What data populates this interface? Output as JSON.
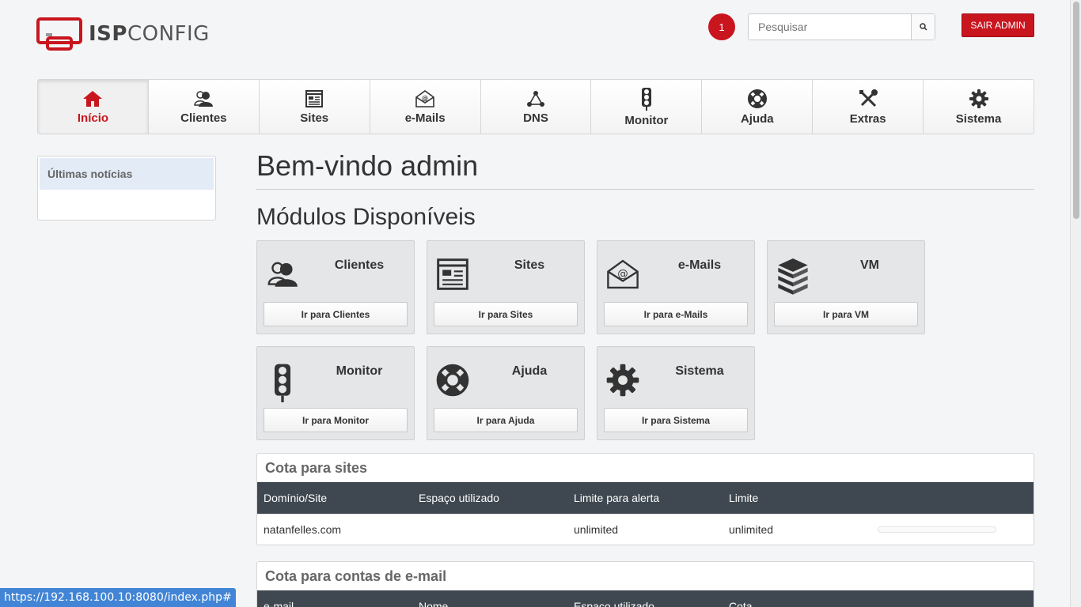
{
  "logo": {
    "text_bold": "ISP",
    "text_regular": "CONFIG"
  },
  "header": {
    "notification_count": "1",
    "search_placeholder": "Pesquisar",
    "logout_label": "SAIR ADMIN"
  },
  "nav": {
    "items": [
      {
        "label": "Início",
        "icon": "home-icon",
        "active": true
      },
      {
        "label": "Clientes",
        "icon": "users-icon"
      },
      {
        "label": "Sites",
        "icon": "web-page-icon"
      },
      {
        "label": "e-Mails",
        "icon": "mail-icon"
      },
      {
        "label": "DNS",
        "icon": "dns-icon"
      },
      {
        "label": "Monitor",
        "icon": "traffic-light-icon"
      },
      {
        "label": "Ajuda",
        "icon": "lifebuoy-icon"
      },
      {
        "label": "Extras",
        "icon": "tools-icon"
      },
      {
        "label": "Sistema",
        "icon": "gear-icon"
      }
    ]
  },
  "sidebar": {
    "items": [
      {
        "label": "Últimas notícias"
      }
    ]
  },
  "content": {
    "welcome_title": "Bem-vindo admin",
    "modules_title": "Módulos Disponíveis",
    "modules": [
      {
        "title": "Clientes",
        "button": "Ir para Clientes",
        "icon": "users-icon"
      },
      {
        "title": "Sites",
        "button": "Ir para Sites",
        "icon": "web-page-icon"
      },
      {
        "title": "e-Mails",
        "button": "Ir para e-Mails",
        "icon": "mail-icon"
      },
      {
        "title": "VM",
        "button": "Ir para VM",
        "icon": "server-stack-icon"
      },
      {
        "title": "Monitor",
        "button": "Ir para Monitor",
        "icon": "traffic-light-icon"
      },
      {
        "title": "Ajuda",
        "button": "Ir para Ajuda",
        "icon": "lifebuoy-icon"
      },
      {
        "title": "Sistema",
        "button": "Ir para Sistema",
        "icon": "gear-icon"
      }
    ]
  },
  "site_quota": {
    "title": "Cota para sites",
    "headers": [
      "Domínio/Site",
      "Espaço utilizado",
      "Limite para alerta",
      "Limite"
    ],
    "rows": [
      {
        "domain": "natanfelles.com",
        "used": "",
        "alert_limit": "unlimited",
        "limit": "unlimited"
      }
    ]
  },
  "email_quota": {
    "title": "Cota para contas de e-mail",
    "headers": [
      "e-mail",
      "Nome",
      "Espaço utilizado",
      "Cota"
    ]
  },
  "statusbar": {
    "url": "https://192.168.100.10:8080/index.php#"
  },
  "colors": {
    "brand_red": "#c8151e",
    "table_header": "#3f4850",
    "status_blue": "#4285d6"
  }
}
